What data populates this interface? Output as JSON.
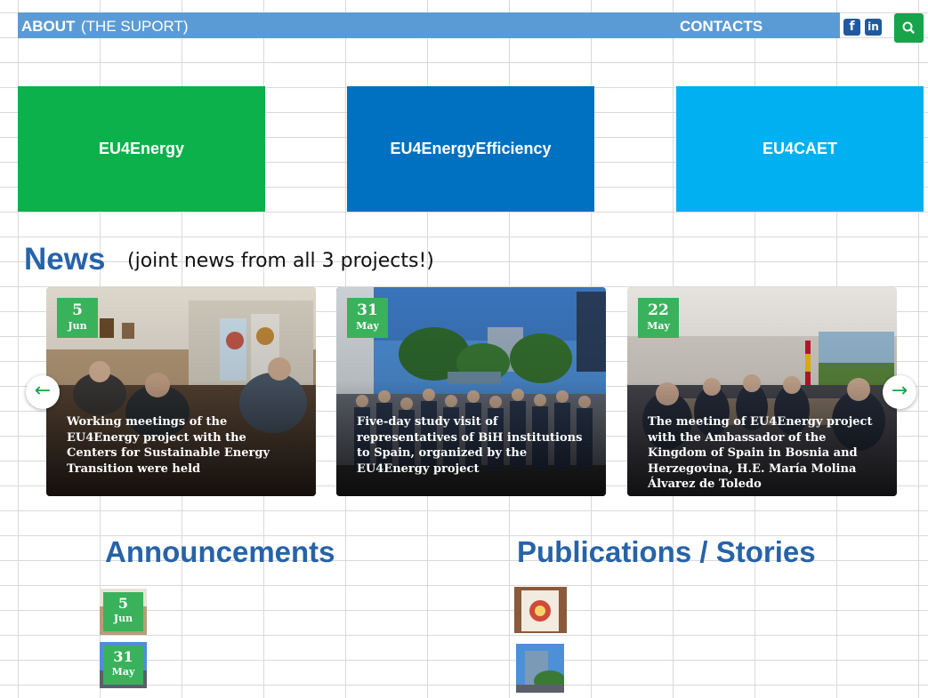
{
  "topnav": {
    "about_label": "ABOUT",
    "about_sub": "(THE SUPORT)",
    "contacts_label": "CONTACTS",
    "facebook_glyph": "f",
    "linkedin_glyph": "in"
  },
  "projects": [
    {
      "label": "EU4Energy",
      "color": "#0db14b"
    },
    {
      "label": "EU4EnergyEfficiency",
      "color": "#0070c0"
    },
    {
      "label": "EU4CAET",
      "color": "#00b0f0"
    }
  ],
  "news": {
    "title": "News",
    "subtitle": "(joint news from all 3 projects!)",
    "cards": [
      {
        "day": "5",
        "month": "Jun",
        "title": "Working meetings of the EU4Energy project with the Centers for Sustainable Energy Transition were held"
      },
      {
        "day": "31",
        "month": "May",
        "title": "Five-day study visit of representatives of BiH institutions to Spain, organized by the EU4Energy project"
      },
      {
        "day": "22",
        "month": "May",
        "title": "The meeting of EU4Energy project with the Ambassador of the Kingdom of Spain in Bosnia and Herzegovina, H.E. María Molina Álvarez de Toledo"
      }
    ],
    "prev_glyph": "←",
    "next_glyph": "→"
  },
  "announcements": {
    "title": "Announcements",
    "items": [
      {
        "day": "5",
        "month": "Jun"
      },
      {
        "day": "31",
        "month": "May"
      }
    ]
  },
  "publications": {
    "title": "Publications / Stories"
  },
  "colors": {
    "topbar": "#5b9bd5",
    "heading_blue": "#2763a8",
    "badge_green": "#39b25b",
    "search_green": "#17a44b"
  }
}
